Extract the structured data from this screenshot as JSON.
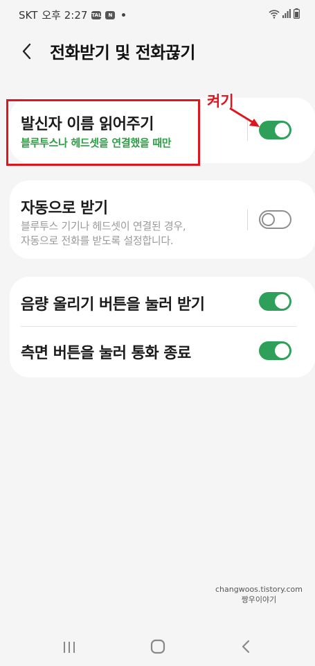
{
  "status_bar": {
    "carrier": "SKT",
    "time": "오후 2:27",
    "icons": [
      "talk-icon",
      "notification-icon",
      "wifi-icon",
      "signal-icon",
      "battery-icon"
    ]
  },
  "header": {
    "title": "전화받기 및 전화끊기"
  },
  "annotation": {
    "label": "켜기",
    "color": "#e0141c"
  },
  "settings": [
    {
      "title": "발신자 이름 읽어주기",
      "subtitle": "블루투스나 헤드셋을 연결했을 때만",
      "enabled": true
    },
    {
      "title": "자동으로 받기",
      "subtitle_lines": [
        "블루투스 기기나 헤드셋이 연결된 경우,",
        "자동으로 전화를 받도록 설정합니다."
      ],
      "enabled": false
    },
    {
      "title": "음량 올리기 버튼을 눌러 받기",
      "enabled": true
    },
    {
      "title": "측면 버튼을 눌러 통화 종료",
      "enabled": true
    }
  ],
  "watermark": {
    "site": "changwoos.tistory.com",
    "name": "짱우이야기"
  },
  "colors": {
    "toggle_on": "#2ea05a",
    "subtitle_green": "#2e9d45",
    "background": "#f5f5f5"
  },
  "nav_bar": {
    "buttons": [
      "recent-apps-icon",
      "home-icon",
      "back-icon"
    ]
  }
}
